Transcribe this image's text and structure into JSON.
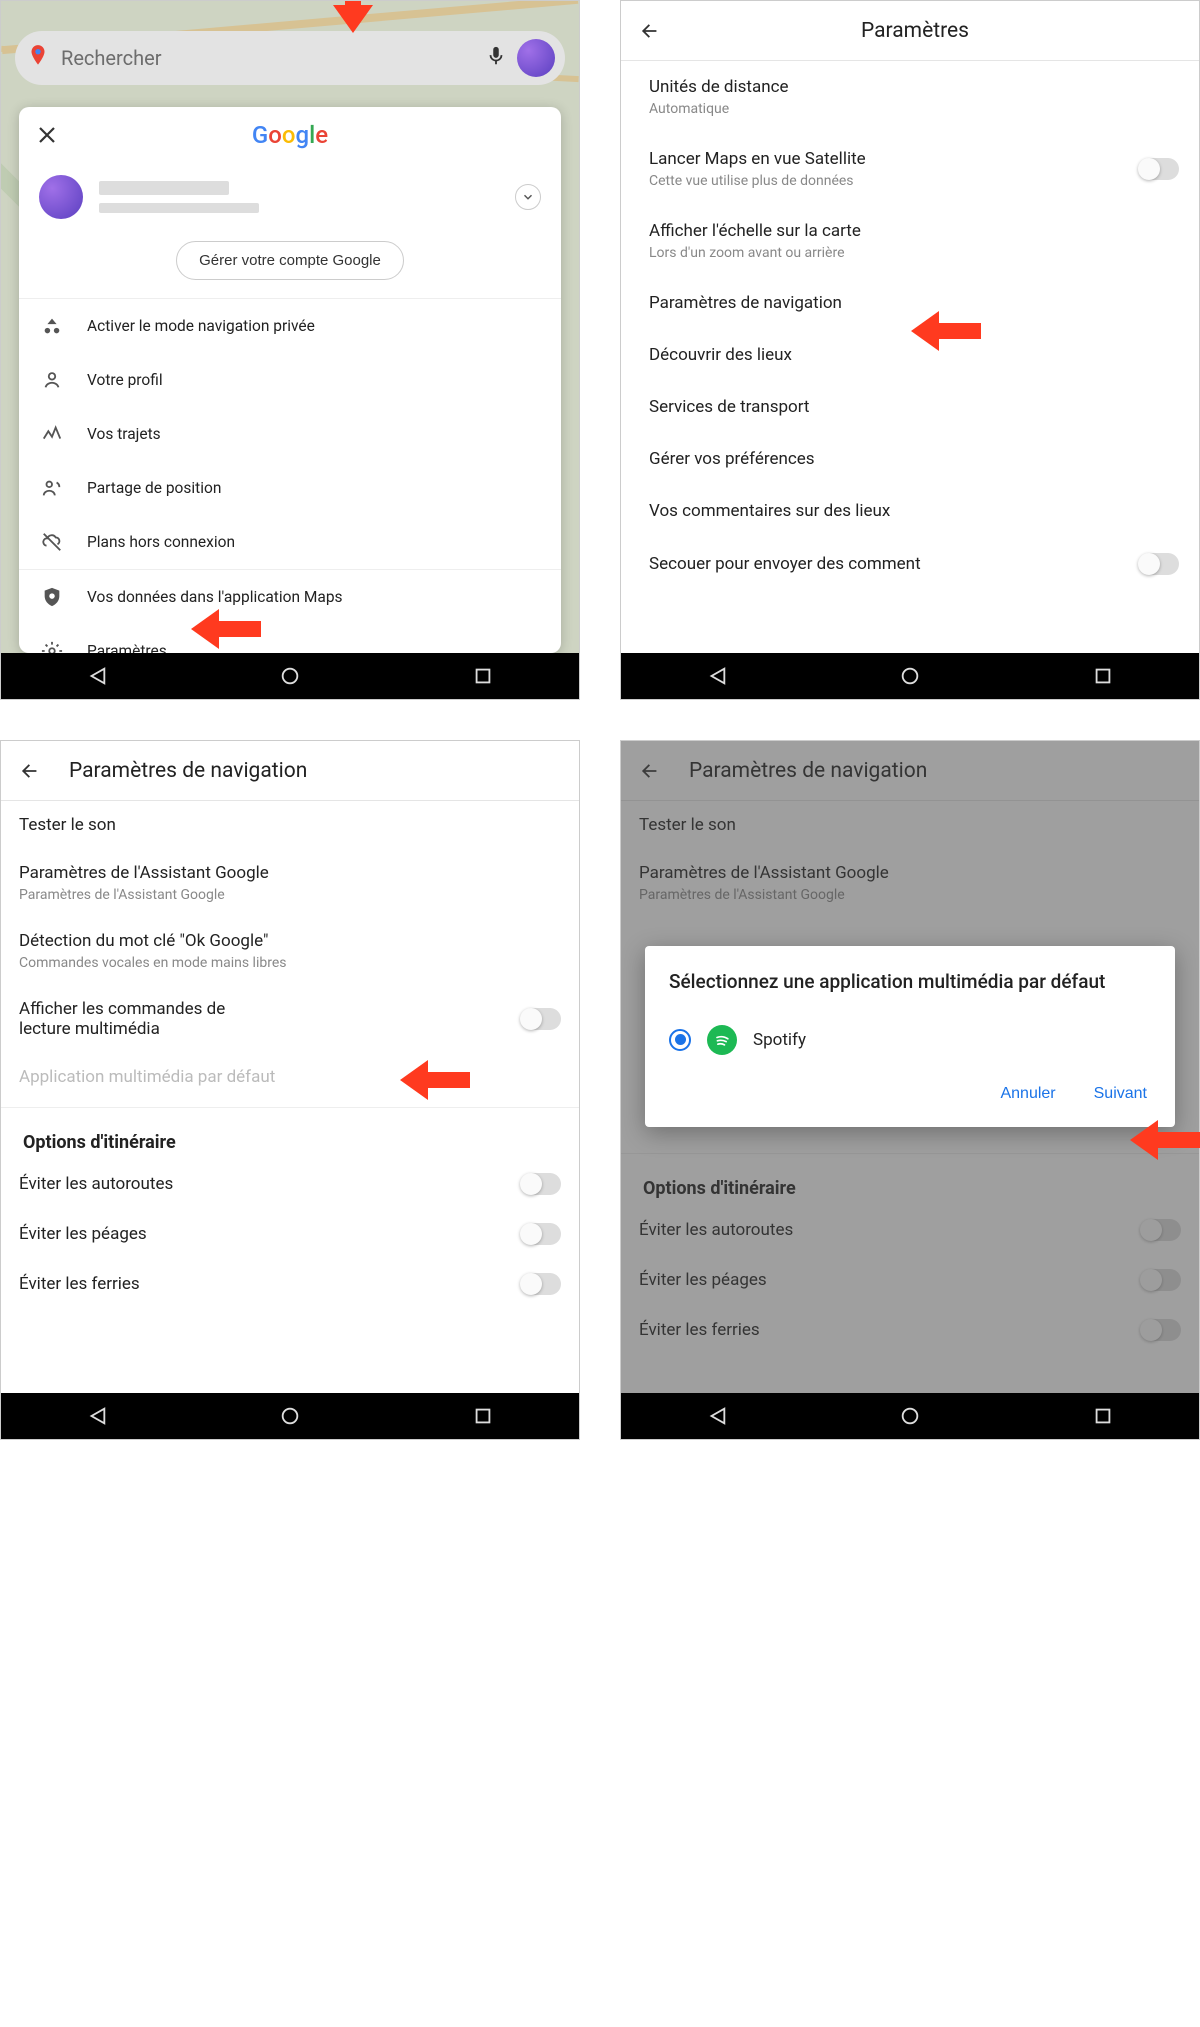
{
  "screen1": {
    "search_placeholder": "Rechercher",
    "logo_letters": [
      "G",
      "o",
      "o",
      "g",
      "l",
      "e"
    ],
    "manage_account": "Gérer votre compte Google",
    "menu": {
      "incognito": "Activer le mode navigation privée",
      "profile": "Votre profil",
      "trips": "Vos trajets",
      "location_share": "Partage de position",
      "offline": "Plans hors connexion",
      "your_data": "Vos données dans l'application Maps",
      "settings": "Paramètres"
    }
  },
  "screen2": {
    "title": "Paramètres",
    "items": {
      "units": {
        "p": "Unités de distance",
        "s": "Automatique"
      },
      "satellite": {
        "p": "Lancer Maps en vue Satellite",
        "s": "Cette vue utilise plus de données"
      },
      "scale": {
        "p": "Afficher l'échelle sur la carte",
        "s": "Lors d'un zoom avant ou arrière"
      },
      "nav_settings": {
        "p": "Paramètres de navigation"
      },
      "discover": {
        "p": "Découvrir des lieux"
      },
      "transport": {
        "p": "Services de transport"
      },
      "preferences": {
        "p": "Gérer vos préférences"
      },
      "comments": {
        "p": "Vos commentaires sur des lieux"
      },
      "shake": {
        "p": "Secouer pour envoyer des comment"
      }
    }
  },
  "screen3": {
    "title": "Paramètres de navigation",
    "items": {
      "test_sound": {
        "p": "Tester le son"
      },
      "assistant": {
        "p": "Paramètres de l'Assistant Google",
        "s": "Paramètres de l'Assistant Google"
      },
      "okgoogle": {
        "p": "Détection du mot clé \"Ok Google\"",
        "s": "Commandes vocales en mode mains libres"
      },
      "media_controls": {
        "p": "Afficher les commandes de lecture multimédia"
      },
      "default_media": {
        "p": "Application multimédia par défaut"
      }
    },
    "section_route": "Options d'itinéraire",
    "route": {
      "highways": "Éviter les autoroutes",
      "tolls": "Éviter les péages",
      "ferries": "Éviter les ferries"
    }
  },
  "screen4": {
    "title": "Paramètres de navigation",
    "dialog": {
      "title": "Sélectionnez une application multimédia par défaut",
      "option": "Spotify",
      "cancel": "Annuler",
      "next": "Suivant"
    }
  },
  "arrow_color": "#ff3a1f"
}
